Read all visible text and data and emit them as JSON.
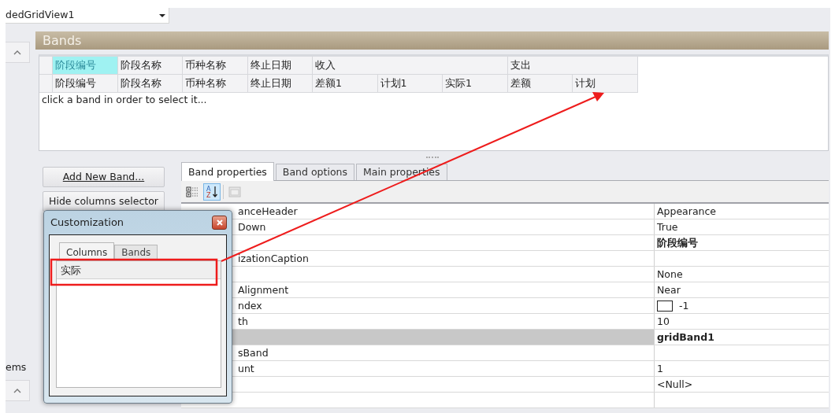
{
  "view_selector": {
    "value": "dedGridView1"
  },
  "bands_panel": {
    "title": "Bands",
    "bands": [
      {
        "text": "阶段编号",
        "selected": true,
        "columns": [
          {
            "text": "阶段编号"
          }
        ]
      },
      {
        "text": "阶段名称",
        "selected": false,
        "columns": [
          {
            "text": "阶段名称"
          }
        ]
      },
      {
        "text": "币种名称",
        "selected": false,
        "columns": [
          {
            "text": "币种名称"
          }
        ]
      },
      {
        "text": "终止日期",
        "selected": false,
        "columns": [
          {
            "text": "终止日期"
          }
        ]
      },
      {
        "text": "收入",
        "selected": false,
        "columns": [
          {
            "text": "差额1"
          },
          {
            "text": "计划1"
          },
          {
            "text": "实际1"
          }
        ]
      },
      {
        "text": "支出",
        "selected": false,
        "columns": [
          {
            "text": "差额"
          },
          {
            "text": "计划"
          }
        ]
      }
    ],
    "hint": "click a band in order to select it..."
  },
  "buttons": [
    {
      "label": "Add New Band...",
      "underlined": true
    },
    {
      "label": "Hide columns selector",
      "underlined": false
    }
  ],
  "tabs": [
    {
      "label": "Band properties",
      "selected": true
    },
    {
      "label": "Band options",
      "selected": false
    },
    {
      "label": "Main properties",
      "selected": false
    }
  ],
  "toolbar": [
    {
      "kind": "categorized",
      "selected": false,
      "disabled": false
    },
    {
      "kind": "alphabetical",
      "selected": true,
      "disabled": false,
      "top_letter": "A",
      "bottom_letter": "Z"
    },
    {
      "kind": "pages",
      "selected": false,
      "disabled": true
    }
  ],
  "properties": [
    {
      "name": "anceHeader",
      "value": "Appearance",
      "kind": "text",
      "modified": false,
      "selected": false
    },
    {
      "name": "Down",
      "value": "True",
      "kind": "text",
      "modified": false,
      "selected": false
    },
    {
      "value": "阶段编号",
      "kind": "text",
      "modified": true,
      "selected": false
    },
    {
      "name": "izationCaption",
      "kind": "text",
      "selected": false
    },
    {
      "value": "None",
      "kind": "text",
      "modified": false,
      "selected": false
    },
    {
      "name": "Alignment",
      "value": "Near",
      "kind": "text",
      "modified": false,
      "selected": false
    },
    {
      "name": "ndex",
      "value": "-1",
      "kind": "color",
      "modified": false,
      "selected": false
    },
    {
      "name": "th",
      "value": "10",
      "kind": "text",
      "modified": false,
      "selected": false
    },
    {
      "value": "gridBand1",
      "kind": "text",
      "modified": true,
      "selected": true
    },
    {
      "name": "sBand",
      "kind": "text",
      "selected": false
    },
    {
      "name": "unt",
      "value": "1",
      "kind": "text",
      "modified": false,
      "selected": false
    },
    {
      "value": "<Null>",
      "kind": "text",
      "modified": false,
      "selected": false
    },
    {
      "kind": "text",
      "selected": false
    }
  ],
  "side_label": "ems",
  "dialog": {
    "title": "Customization",
    "tabs": [
      {
        "label": "Columns",
        "selected": true
      },
      {
        "label": "Bands",
        "selected": false
      }
    ],
    "items": [
      {
        "text": "实际"
      }
    ]
  }
}
